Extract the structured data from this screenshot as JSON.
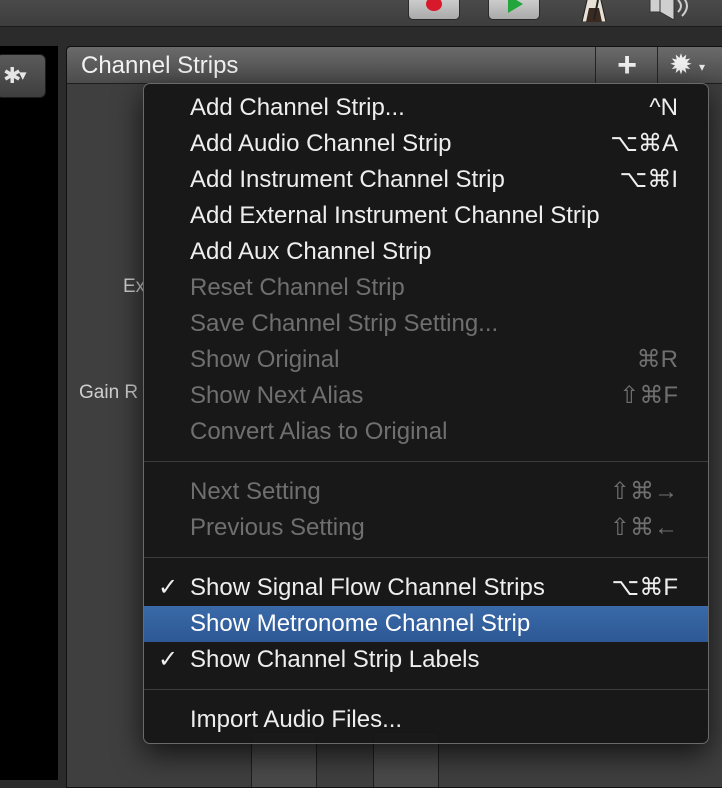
{
  "panel": {
    "title": "Channel Strips"
  },
  "background_labels": {
    "label1": "Ex",
    "label2": "Gain R"
  },
  "menu": {
    "groups": [
      [
        {
          "label": "Add Channel Strip...",
          "shortcut": "^N",
          "enabled": true,
          "checked": false
        },
        {
          "label": "Add Audio Channel Strip",
          "shortcut": "⌥⌘A",
          "enabled": true,
          "checked": false
        },
        {
          "label": "Add Instrument Channel Strip",
          "shortcut": "⌥⌘I",
          "enabled": true,
          "checked": false
        },
        {
          "label": "Add External Instrument Channel Strip",
          "shortcut": "",
          "enabled": true,
          "checked": false
        },
        {
          "label": "Add Aux Channel Strip",
          "shortcut": "",
          "enabled": true,
          "checked": false
        },
        {
          "label": "Reset Channel Strip",
          "shortcut": "",
          "enabled": false,
          "checked": false
        },
        {
          "label": "Save Channel Strip Setting...",
          "shortcut": "",
          "enabled": false,
          "checked": false
        },
        {
          "label": "Show Original",
          "shortcut": "⌘R",
          "enabled": false,
          "checked": false
        },
        {
          "label": "Show Next Alias",
          "shortcut": "⇧⌘F",
          "enabled": false,
          "checked": false
        },
        {
          "label": "Convert Alias to Original",
          "shortcut": "",
          "enabled": false,
          "checked": false
        }
      ],
      [
        {
          "label": "Next Setting",
          "shortcut": "⇧⌘→",
          "enabled": false,
          "checked": false
        },
        {
          "label": "Previous Setting",
          "shortcut": "⇧⌘←",
          "enabled": false,
          "checked": false
        }
      ],
      [
        {
          "label": "Show Signal Flow Channel Strips",
          "shortcut": "⌥⌘F",
          "enabled": true,
          "checked": true
        },
        {
          "label": "Show Metronome Channel Strip",
          "shortcut": "",
          "enabled": true,
          "checked": false,
          "highlighted": true
        },
        {
          "label": "Show Channel Strip Labels",
          "shortcut": "",
          "enabled": true,
          "checked": true
        }
      ],
      [
        {
          "label": "Import Audio Files...",
          "shortcut": "",
          "enabled": true,
          "checked": false
        }
      ]
    ],
    "check_glyph": "✓"
  },
  "colors": {
    "highlight": "#2f5c9a",
    "record": "#d8182b",
    "play": "#22a53a"
  }
}
